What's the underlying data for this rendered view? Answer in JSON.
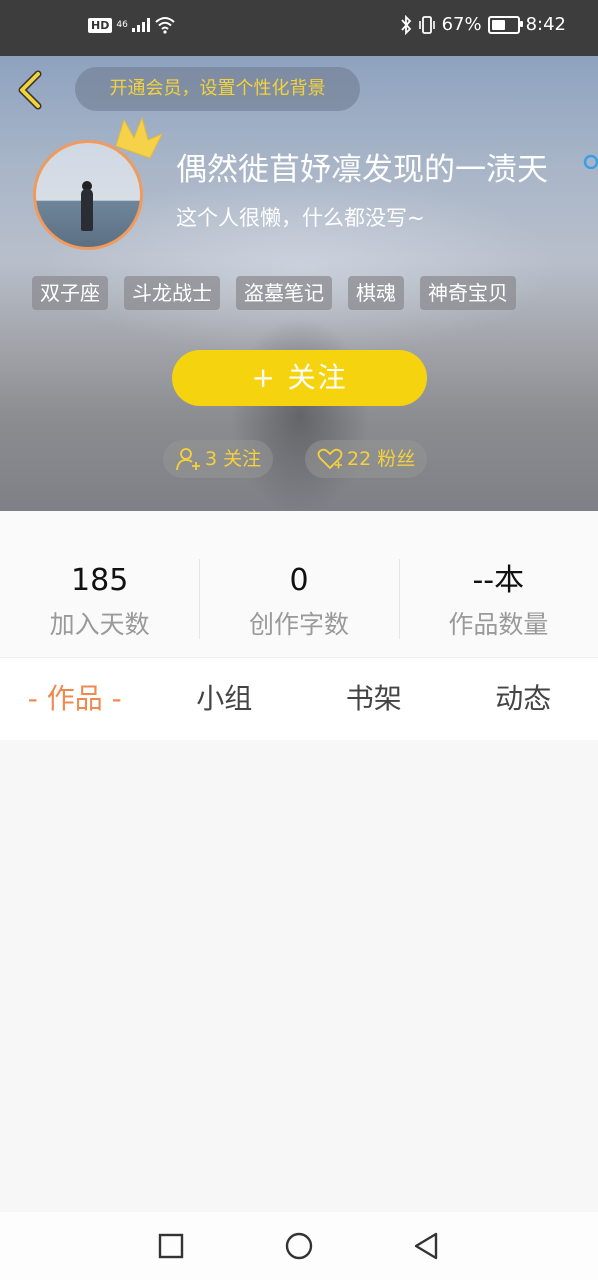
{
  "status_bar": {
    "left_label": "HD",
    "network": "46",
    "battery": "67%",
    "battery_level": 0.67,
    "time": "8:42"
  },
  "header": {
    "vip_text": "开通会员，设置个性化背景"
  },
  "profile": {
    "username": "偶然徙苜妤凛发现的一渍天",
    "bio": "这个人很懒，什么都没写~",
    "tags": [
      "双子座",
      "斗龙战士",
      "盗墓笔记",
      "棋魂",
      "神奇宝贝"
    ],
    "follow_label": "+  关注",
    "following": "3 关注",
    "fans": "22 粉丝"
  },
  "stats": [
    {
      "value": "185",
      "label": "加入天数"
    },
    {
      "value": "0",
      "label": "创作字数"
    },
    {
      "value": "--本",
      "label": "作品数量"
    }
  ],
  "tabs": [
    {
      "label": "- 作品 -",
      "active": true
    },
    {
      "label": "小组",
      "active": false
    },
    {
      "label": "书架",
      "active": false
    },
    {
      "label": "动态",
      "active": false
    }
  ],
  "colors": {
    "accent": "#ef8a4f",
    "follow_button": "#f5d40f",
    "vip_text": "#f4d23a",
    "avatar_border": "#f09a5d"
  }
}
